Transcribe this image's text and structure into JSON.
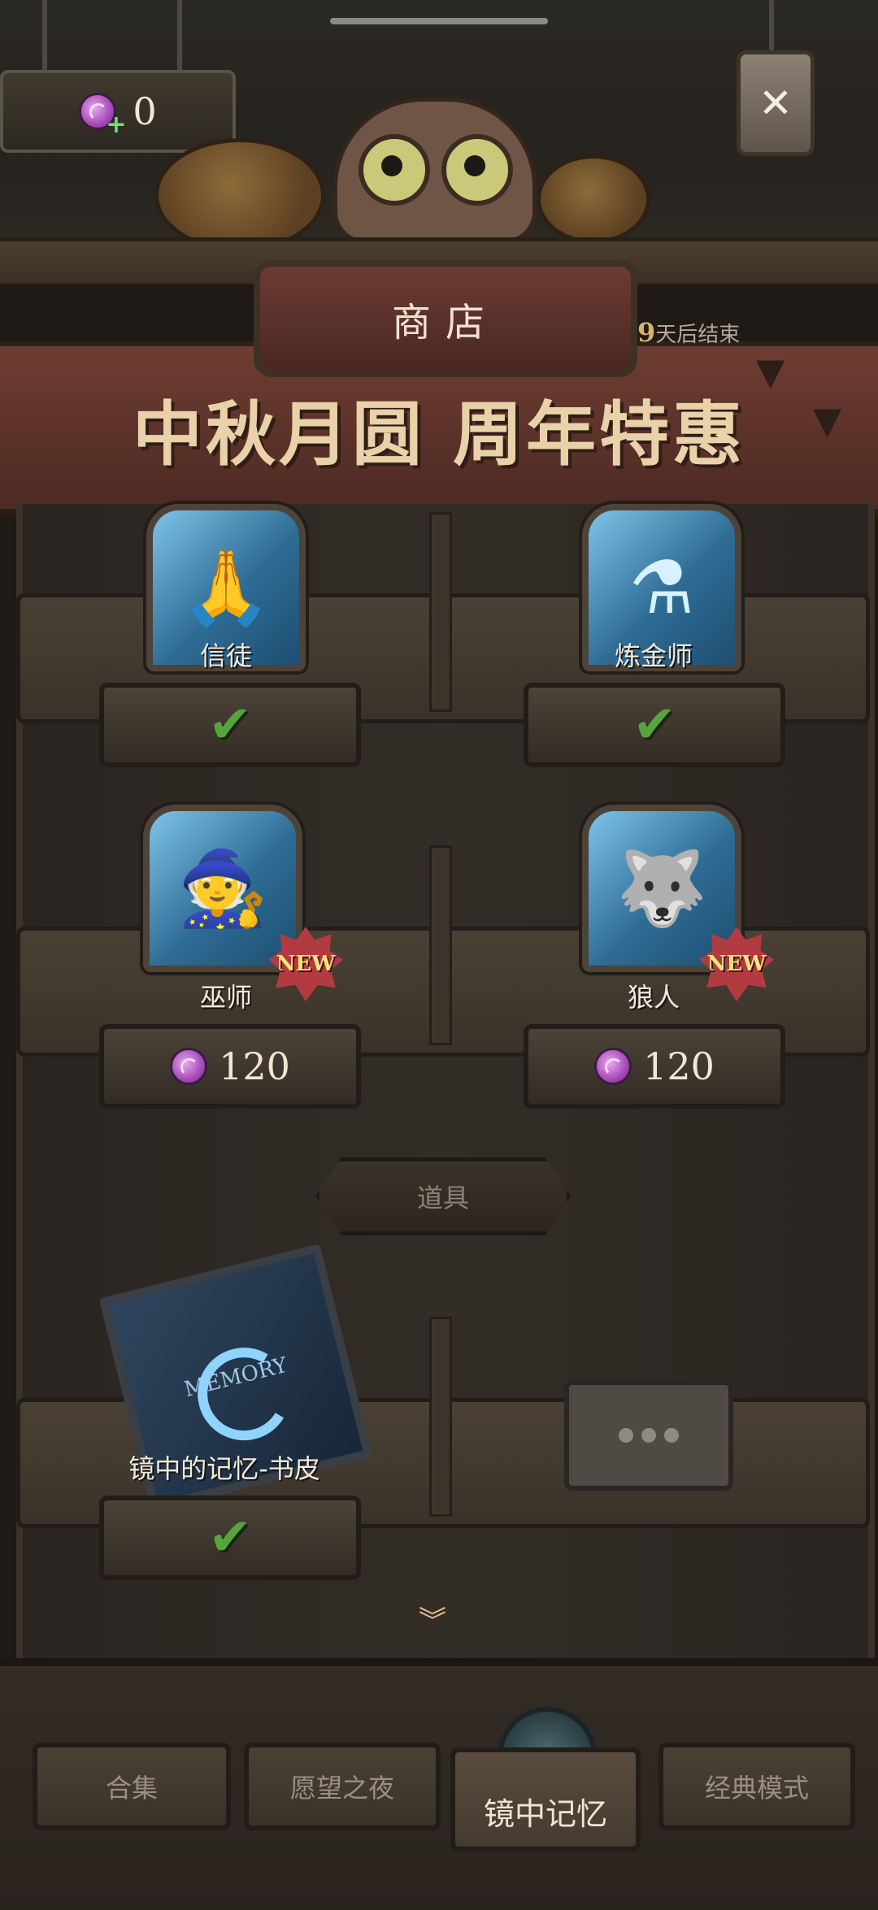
{
  "currency": {
    "icon": "candy-icon",
    "plus_icon": "plus-icon",
    "amount": "0"
  },
  "header": {
    "title": "商店",
    "days_left_number": "9",
    "days_left_suffix": "天后结束",
    "banner_title": "中秋月圆 周年特惠",
    "close_icon": "close-icon"
  },
  "roles": [
    {
      "name": "信徒",
      "icon": "praying-hands-icon",
      "status": "owned",
      "is_new": false
    },
    {
      "name": "炼金师",
      "icon": "potion-flask-icon",
      "status": "owned",
      "is_new": false
    },
    {
      "name": "巫师",
      "icon": "wizard-hat-icon",
      "price": "120",
      "is_new": true,
      "badge": "NEW"
    },
    {
      "name": "狼人",
      "icon": "wolf-head-icon",
      "price": "120",
      "is_new": true,
      "badge": "NEW"
    }
  ],
  "items_section": {
    "label": "道具",
    "items": [
      {
        "name": "镜中的记忆-书皮",
        "book_text": "MEMORY",
        "status": "owned"
      },
      {
        "name": "",
        "status": "more"
      }
    ]
  },
  "bottom_nav": {
    "tabs": [
      {
        "label": "合集",
        "active": false
      },
      {
        "label": "愿望之夜",
        "active": false
      },
      {
        "label": "镜中记忆",
        "active": true
      },
      {
        "label": "经典模式",
        "active": false
      }
    ]
  },
  "colors": {
    "banner": "#5a3128",
    "card_blue": "#2e6c94",
    "check_green": "#57a43d",
    "new_badge": "#b23b42"
  }
}
